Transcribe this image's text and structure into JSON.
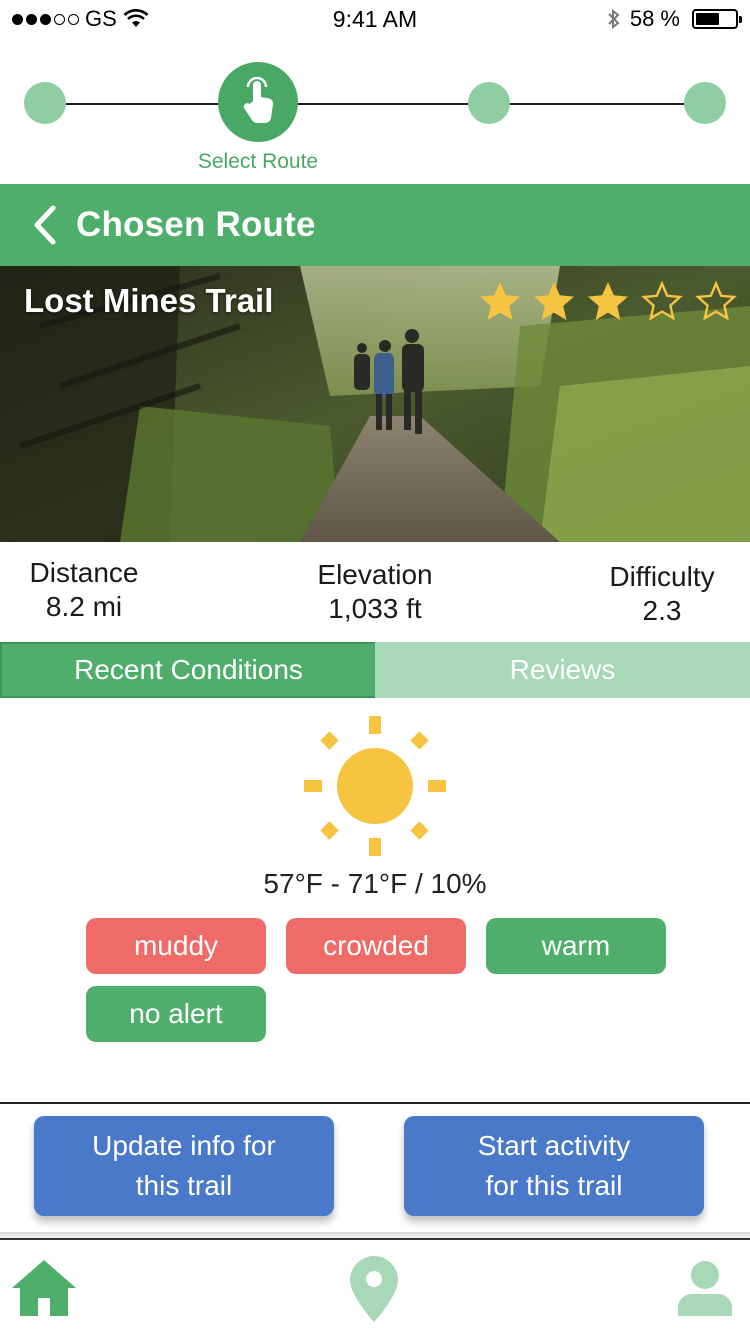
{
  "status_bar": {
    "carrier": "GS",
    "time": "9:41 AM",
    "battery_text": "58 %",
    "battery_level": 0.58
  },
  "stepper": {
    "active_label": "Select Route",
    "steps": 4,
    "active_index": 1
  },
  "header": {
    "title": "Chosen Route"
  },
  "trail": {
    "name": "Lost Mines Trail",
    "rating": 3,
    "rating_max": 5
  },
  "stats": {
    "distance_label": "Distance",
    "distance_value": "8.2 mi",
    "elevation_label": "Elevation",
    "elevation_value": "1,033 ft",
    "difficulty_label": "Difficulty",
    "difficulty_value": "2.3"
  },
  "tabs": {
    "conditions": "Recent Conditions",
    "reviews": "Reviews"
  },
  "weather": {
    "icon": "sun-icon",
    "summary": "57°F - 71°F / 10%"
  },
  "tags": {
    "muddy": "muddy",
    "crowded": "crowded",
    "warm": "warm",
    "no_alert": "no alert"
  },
  "actions": {
    "update_line1": "Update info for",
    "update_line2": "this trail",
    "start_line1": "Start activity",
    "start_line2": "for this trail"
  },
  "colors": {
    "primary_green": "#4fae6b",
    "light_green": "#a8d8b7",
    "alert_red": "#ef6b68",
    "action_blue": "#4a79c9",
    "sun_yellow": "#f6c441"
  },
  "nav": {
    "home": "home-icon",
    "map": "map-pin-icon",
    "profile": "user-icon"
  }
}
